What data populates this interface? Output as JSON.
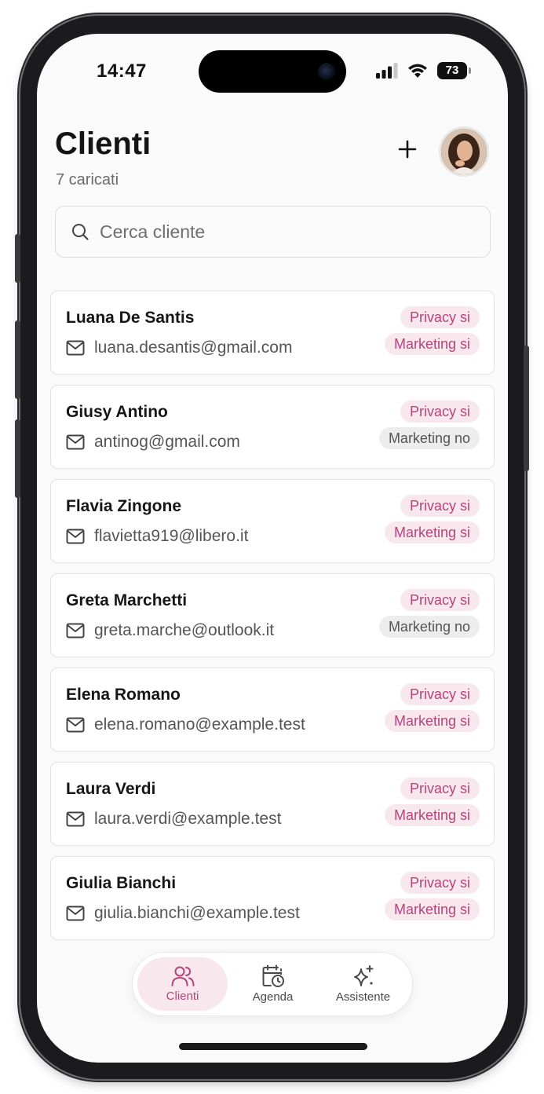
{
  "status_bar": {
    "time": "14:47",
    "battery": "73"
  },
  "header": {
    "title": "Clienti",
    "subtitle": "7 caricati",
    "add_icon": "plus-icon"
  },
  "search": {
    "placeholder": "Cerca cliente",
    "value": ""
  },
  "clients": [
    {
      "name": "Luana De Santis",
      "email": "luana.desantis@gmail.com",
      "privacy": "Privacy si",
      "privacy_on": true,
      "marketing": "Marketing si",
      "marketing_on": true
    },
    {
      "name": "Giusy Antino",
      "email": "antinog@gmail.com",
      "privacy": "Privacy si",
      "privacy_on": true,
      "marketing": "Marketing no",
      "marketing_on": false
    },
    {
      "name": "Flavia Zingone",
      "email": "flavietta919@libero.it",
      "privacy": "Privacy si",
      "privacy_on": true,
      "marketing": "Marketing si",
      "marketing_on": true
    },
    {
      "name": "Greta Marchetti",
      "email": "greta.marche@outlook.it",
      "privacy": "Privacy si",
      "privacy_on": true,
      "marketing": "Marketing no",
      "marketing_on": false
    },
    {
      "name": "Elena Romano",
      "email": "elena.romano@example.test",
      "privacy": "Privacy si",
      "privacy_on": true,
      "marketing": "Marketing si",
      "marketing_on": true
    },
    {
      "name": "Laura Verdi",
      "email": "laura.verdi@example.test",
      "privacy": "Privacy si",
      "privacy_on": true,
      "marketing": "Marketing si",
      "marketing_on": true
    },
    {
      "name": "Giulia Bianchi",
      "email": "giulia.bianchi@example.test",
      "privacy": "Privacy si",
      "privacy_on": true,
      "marketing": "Marketing si",
      "marketing_on": true
    }
  ],
  "tabs": [
    {
      "label": "Clienti",
      "icon": "users-icon",
      "active": true
    },
    {
      "label": "Agenda",
      "icon": "calendar-clock-icon",
      "active": false
    },
    {
      "label": "Assistente",
      "icon": "sparkles-icon",
      "active": false
    }
  ],
  "colors": {
    "accent": "#b5457a",
    "accent_bg": "#f9e7ee",
    "neutral_bg": "#ededed"
  }
}
